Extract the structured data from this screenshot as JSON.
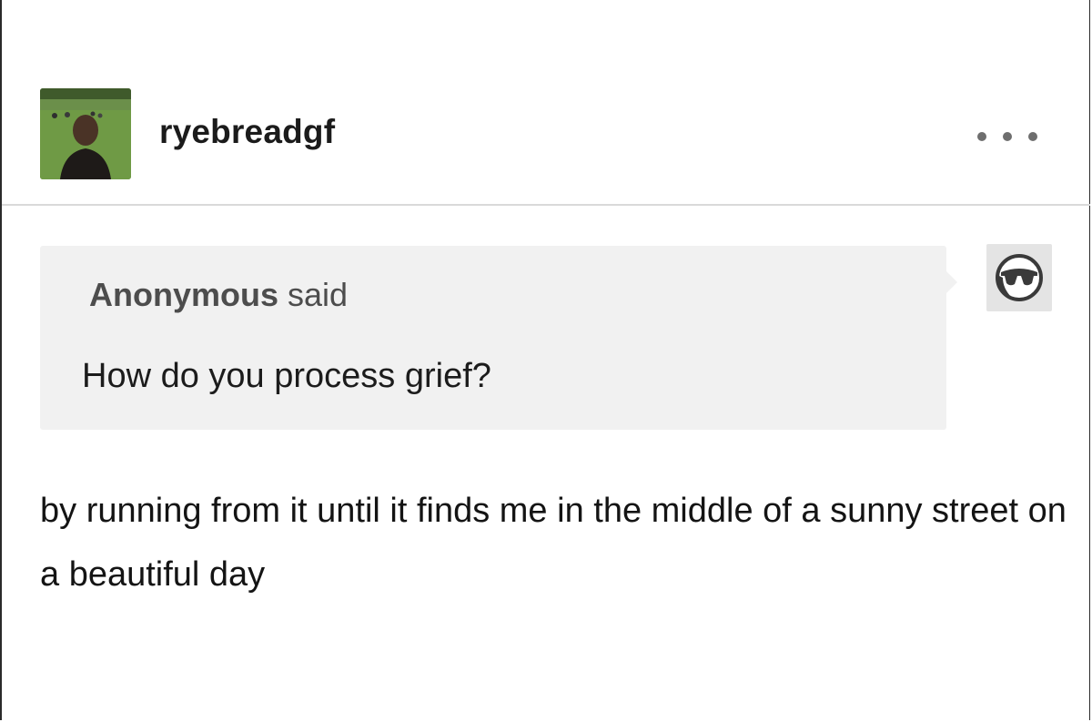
{
  "post": {
    "author": "ryebreadgf",
    "avatar_icon": "profile-photo-person-in-park",
    "more_icon": "ellipsis-icon"
  },
  "ask": {
    "asker": "Anonymous",
    "said": "said",
    "question": "How do you process grief?",
    "asker_icon": "anonymous-sunglasses-icon"
  },
  "answer": {
    "text": "by running from it until it finds me in the middle of a sunny street on a beautiful day"
  },
  "colors": {
    "ask_background": "#f1f1f1",
    "divider": "#d9d9d9",
    "text": "#1a1a1a",
    "muted_text": "#4d4d4d"
  }
}
